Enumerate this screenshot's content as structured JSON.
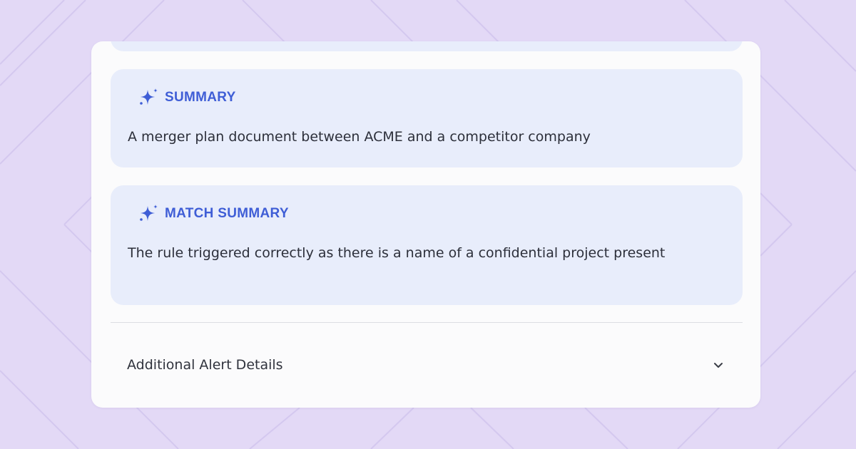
{
  "cards": {
    "summary": {
      "title": "SUMMARY",
      "text": "A merger plan document between ACME and a competitor company",
      "icon": "sparkle-icon"
    },
    "match_summary": {
      "title": "MATCH SUMMARY",
      "text": "The rule triggered correctly as there is a name of a confidential project present",
      "icon": "sparkle-icon"
    }
  },
  "details": {
    "label": "Additional Alert Details",
    "icon": "chevron-down-icon"
  },
  "colors": {
    "background": "#e3d9f6",
    "panel": "#fbfbfc",
    "card": "#e8edfb",
    "accent": "#3f5ed6",
    "text": "#2c2f3a"
  }
}
